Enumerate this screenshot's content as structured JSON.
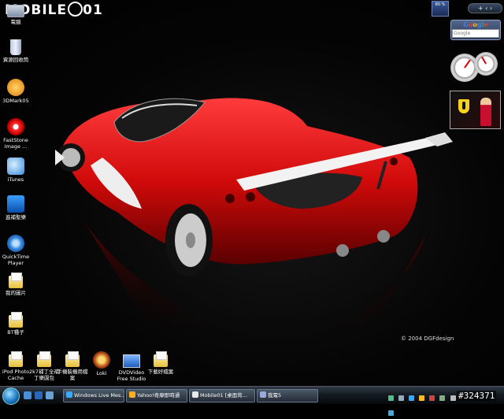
{
  "logo": "MOBILE",
  "logo_suffix": "01",
  "icons": [
    {
      "label": "電腦",
      "name": "computer-icon"
    },
    {
      "label": "資源回收筒",
      "name": "recycle-bin-icon"
    },
    {
      "label": "3DMark05",
      "name": "3dmark-icon"
    },
    {
      "label": "FastStone Image ...",
      "name": "faststone-icon"
    },
    {
      "label": "iTunes",
      "name": "itunes-icon"
    },
    {
      "label": "進補聖樂",
      "name": "music-notes-icon"
    },
    {
      "label": "QuickTime Player",
      "name": "quicktime-icon"
    },
    {
      "label": "我的圖片",
      "name": "my-pictures-folder-icon"
    },
    {
      "label": "BT種子",
      "name": "bt-folder-icon"
    },
    {
      "label": "iPod Photo Cache",
      "name": "ipod-photo-cache-folder-icon"
    },
    {
      "label": "2k7補丁全補丁樂園包",
      "name": "folder-icon"
    },
    {
      "label": "手機裝機用檔案",
      "name": "folder-icon"
    },
    {
      "label": "Loki",
      "name": "loki-icon"
    },
    {
      "label": "DVDVideo Free Studio",
      "name": "dvd-studio-icon"
    },
    {
      "label": "下載好檔案",
      "name": "download-folder-icon"
    }
  ],
  "copyright": "© 2004 DGFdesign",
  "sidebar": {
    "cpu": "80 %",
    "controls": "+ ‹ ›",
    "google_title": [
      "G",
      "o",
      "o",
      "g",
      "l",
      "e"
    ],
    "google_placeholder": "Google"
  },
  "taskbar": {
    "tasks": [
      {
        "label": "Windows Live Mes...",
        "color": "#3aa9ff"
      },
      {
        "label": "Yahoo!奇摩即時通",
        "color": "#ffb020"
      },
      {
        "label": "Mobile01 [桌面背...",
        "color": "#e8e8e8"
      },
      {
        "label": "我電5",
        "color": "#9ad"
      }
    ]
  },
  "watermark": "#324371"
}
